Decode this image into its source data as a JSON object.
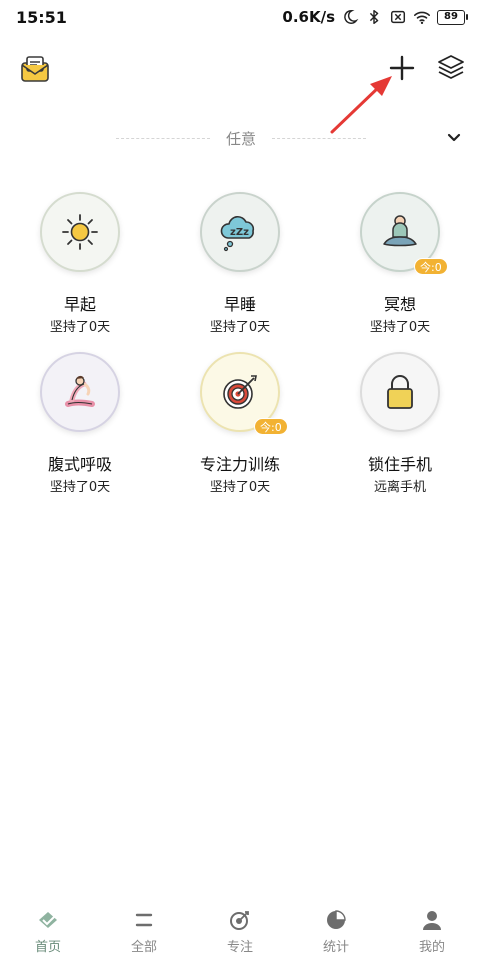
{
  "status_bar": {
    "time": "15:51",
    "net_speed": "0.6K/s",
    "battery": "89",
    "icons": [
      "moon-icon",
      "bluetooth-icon",
      "sim-off-icon",
      "wifi-icon",
      "battery-icon"
    ]
  },
  "toolbar": {
    "left_icon": "mail-icon",
    "right_icons": [
      "add-icon",
      "layers-icon"
    ]
  },
  "category": {
    "label": "任意",
    "chevron_icon": "chevron-down-icon"
  },
  "habits": [
    {
      "name": "早起",
      "sub": "坚持了0天",
      "icon": "sun-icon",
      "badge": "",
      "bg": "#f4f6f2",
      "border": "#d5dccf"
    },
    {
      "name": "早睡",
      "sub": "坚持了0天",
      "icon": "sleep-cloud-icon",
      "badge": "",
      "bg": "#eef2ef",
      "border": "#c9d3cc"
    },
    {
      "name": "冥想",
      "sub": "坚持了0天",
      "icon": "meditation-icon",
      "badge": "今:0",
      "bg": "#edf2ef",
      "border": "#c6d3cb"
    },
    {
      "name": "腹式呼吸",
      "sub": "坚持了0天",
      "icon": "yoga-icon",
      "badge": "",
      "bg": "#f3f2f7",
      "border": "#d6d3e3"
    },
    {
      "name": "专注力训练",
      "sub": "坚持了0天",
      "icon": "target-icon",
      "badge": "今:0",
      "bg": "#fcf9e6",
      "border": "#ece3b0"
    },
    {
      "name": "锁住手机",
      "sub": "远离手机",
      "icon": "lock-icon",
      "badge": "",
      "bg": "#f6f6f6",
      "border": "#dcdcdc"
    }
  ],
  "bottom_nav": [
    {
      "label": "首页",
      "icon": "home-check-icon",
      "active": true
    },
    {
      "label": "全部",
      "icon": "list-icon",
      "active": false
    },
    {
      "label": "专注",
      "icon": "focus-icon",
      "active": false
    },
    {
      "label": "统计",
      "icon": "pie-chart-icon",
      "active": false
    },
    {
      "label": "我的",
      "icon": "user-icon",
      "active": false
    }
  ],
  "colors": {
    "accent": "#6a8c7a",
    "badge": "#f2b233",
    "inactive_tab": "#888888",
    "annotation_arrow": "#e53935"
  }
}
